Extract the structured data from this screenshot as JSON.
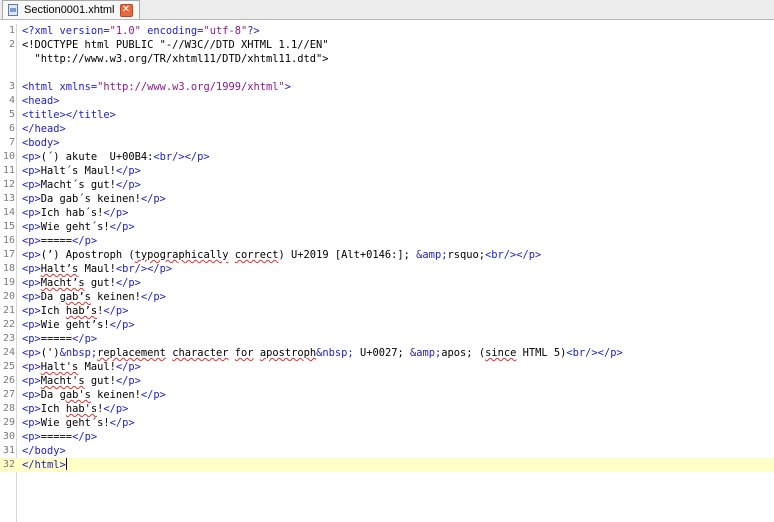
{
  "tab": {
    "label": "Section0001.xhtml",
    "close_glyph": "✕"
  },
  "lines": [
    {
      "n": "1",
      "parts": [
        [
          "tag",
          "<?xml "
        ],
        [
          "attr",
          "version="
        ],
        [
          "val",
          "\"1.0\""
        ],
        [
          "t",
          " "
        ],
        [
          "attr",
          "encoding="
        ],
        [
          "val",
          "\"utf-8\""
        ],
        [
          "tag",
          "?>"
        ]
      ]
    },
    {
      "n": "2",
      "parts": [
        [
          "t",
          "<!DOCTYPE html PUBLIC \"-//W3C//DTD XHTML 1.1//EN\""
        ]
      ]
    },
    {
      "n": "",
      "parts": [
        [
          "t",
          "  \"http://www.w3.org/TR/xhtml11/DTD/xhtml11.dtd\">"
        ]
      ]
    },
    {
      "n": "",
      "parts": []
    },
    {
      "n": "3",
      "parts": [
        [
          "tag",
          "<html "
        ],
        [
          "attr",
          "xmlns="
        ],
        [
          "val",
          "\"http://www.w3.org/1999/xhtml\""
        ],
        [
          "tag",
          ">"
        ]
      ]
    },
    {
      "n": "4",
      "parts": [
        [
          "tag",
          "<head>"
        ]
      ]
    },
    {
      "n": "5",
      "parts": [
        [
          "tag",
          "<title></title>"
        ]
      ]
    },
    {
      "n": "6",
      "parts": [
        [
          "tag",
          "</head>"
        ]
      ]
    },
    {
      "n": "7",
      "parts": [
        [
          "tag",
          "<body>"
        ]
      ]
    },
    {
      "n": "10",
      "parts": [
        [
          "tag",
          "<p>"
        ],
        [
          "t",
          "(´) akute  U+00B4:"
        ],
        [
          "tag",
          "<br/></p>"
        ]
      ]
    },
    {
      "n": "11",
      "parts": [
        [
          "tag",
          "<p>"
        ],
        [
          "t",
          "Halt´s Maul!"
        ],
        [
          "tag",
          "</p>"
        ]
      ]
    },
    {
      "n": "12",
      "parts": [
        [
          "tag",
          "<p>"
        ],
        [
          "t",
          "Macht´s gut!"
        ],
        [
          "tag",
          "</p>"
        ]
      ]
    },
    {
      "n": "13",
      "parts": [
        [
          "tag",
          "<p>"
        ],
        [
          "t",
          "Da gab´s keinen!"
        ],
        [
          "tag",
          "</p>"
        ]
      ]
    },
    {
      "n": "14",
      "parts": [
        [
          "tag",
          "<p>"
        ],
        [
          "t",
          "Ich hab´s!"
        ],
        [
          "tag",
          "</p>"
        ]
      ]
    },
    {
      "n": "15",
      "parts": [
        [
          "tag",
          "<p>"
        ],
        [
          "t",
          "Wie geht´s!"
        ],
        [
          "tag",
          "</p>"
        ]
      ]
    },
    {
      "n": "16",
      "parts": [
        [
          "tag",
          "<p>"
        ],
        [
          "t",
          "====="
        ],
        [
          "tag",
          "</p>"
        ]
      ]
    },
    {
      "n": "17",
      "parts": [
        [
          "tag",
          "<p>"
        ],
        [
          "t",
          "(’) Apostroph ("
        ],
        [
          "u",
          "typographically"
        ],
        [
          "t",
          " "
        ],
        [
          "u",
          "correct"
        ],
        [
          "t",
          ") U+2019 [Alt+0146:]; "
        ],
        [
          "tag",
          "&amp;"
        ],
        [
          "t",
          "rsquo;"
        ],
        [
          "tag",
          "<br/></p>"
        ]
      ]
    },
    {
      "n": "18",
      "parts": [
        [
          "tag",
          "<p>"
        ],
        [
          "u",
          "Halt’s"
        ],
        [
          "t",
          " Maul!"
        ],
        [
          "tag",
          "<br/></p>"
        ]
      ]
    },
    {
      "n": "19",
      "parts": [
        [
          "tag",
          "<p>"
        ],
        [
          "u",
          "Macht’s"
        ],
        [
          "t",
          " gut!"
        ],
        [
          "tag",
          "</p>"
        ]
      ]
    },
    {
      "n": "20",
      "parts": [
        [
          "tag",
          "<p>"
        ],
        [
          "t",
          "Da "
        ],
        [
          "u",
          "gab’s"
        ],
        [
          "t",
          " keinen!"
        ],
        [
          "tag",
          "</p>"
        ]
      ]
    },
    {
      "n": "21",
      "parts": [
        [
          "tag",
          "<p>"
        ],
        [
          "t",
          "Ich "
        ],
        [
          "u",
          "hab’s"
        ],
        [
          "t",
          "!"
        ],
        [
          "tag",
          "</p>"
        ]
      ]
    },
    {
      "n": "22",
      "parts": [
        [
          "tag",
          "<p>"
        ],
        [
          "t",
          "Wie geht’s!"
        ],
        [
          "tag",
          "</p>"
        ]
      ]
    },
    {
      "n": "23",
      "parts": [
        [
          "tag",
          "<p>"
        ],
        [
          "t",
          "====="
        ],
        [
          "tag",
          "</p>"
        ]
      ]
    },
    {
      "n": "24",
      "parts": [
        [
          "tag",
          "<p>"
        ],
        [
          "t",
          "(')"
        ],
        [
          "tag",
          "&nbsp;"
        ],
        [
          "u",
          "replacement"
        ],
        [
          "t",
          " "
        ],
        [
          "u",
          "character"
        ],
        [
          "t",
          " "
        ],
        [
          "u",
          "for"
        ],
        [
          "t",
          " "
        ],
        [
          "u",
          "apostroph"
        ],
        [
          "tag",
          "&nbsp;"
        ],
        [
          "t",
          " U+0027; "
        ],
        [
          "tag",
          "&amp;"
        ],
        [
          "t",
          "apos; ("
        ],
        [
          "u",
          "since"
        ],
        [
          "t",
          " HTML 5)"
        ],
        [
          "tag",
          "<br/></p>"
        ]
      ]
    },
    {
      "n": "25",
      "parts": [
        [
          "tag",
          "<p>"
        ],
        [
          "u",
          "Halt's"
        ],
        [
          "t",
          " Maul!"
        ],
        [
          "tag",
          "</p>"
        ]
      ]
    },
    {
      "n": "26",
      "parts": [
        [
          "tag",
          "<p>"
        ],
        [
          "u",
          "Macht's"
        ],
        [
          "t",
          " gut!"
        ],
        [
          "tag",
          "</p>"
        ]
      ]
    },
    {
      "n": "27",
      "parts": [
        [
          "tag",
          "<p>"
        ],
        [
          "t",
          "Da "
        ],
        [
          "u",
          "gab's"
        ],
        [
          "t",
          " keinen!"
        ],
        [
          "tag",
          "</p>"
        ]
      ]
    },
    {
      "n": "28",
      "parts": [
        [
          "tag",
          "<p>"
        ],
        [
          "t",
          "Ich "
        ],
        [
          "u",
          "hab's"
        ],
        [
          "t",
          "!"
        ],
        [
          "tag",
          "</p>"
        ]
      ]
    },
    {
      "n": "29",
      "parts": [
        [
          "tag",
          "<p>"
        ],
        [
          "t",
          "Wie geht´s!"
        ],
        [
          "tag",
          "</p>"
        ]
      ]
    },
    {
      "n": "30",
      "parts": [
        [
          "tag",
          "<p>"
        ],
        [
          "t",
          "====="
        ],
        [
          "tag",
          "</p>"
        ]
      ]
    },
    {
      "n": "31",
      "parts": [
        [
          "tag",
          "</body>"
        ]
      ]
    },
    {
      "n": "32",
      "parts": [
        [
          "tag",
          "</html>"
        ]
      ],
      "current": true
    }
  ]
}
